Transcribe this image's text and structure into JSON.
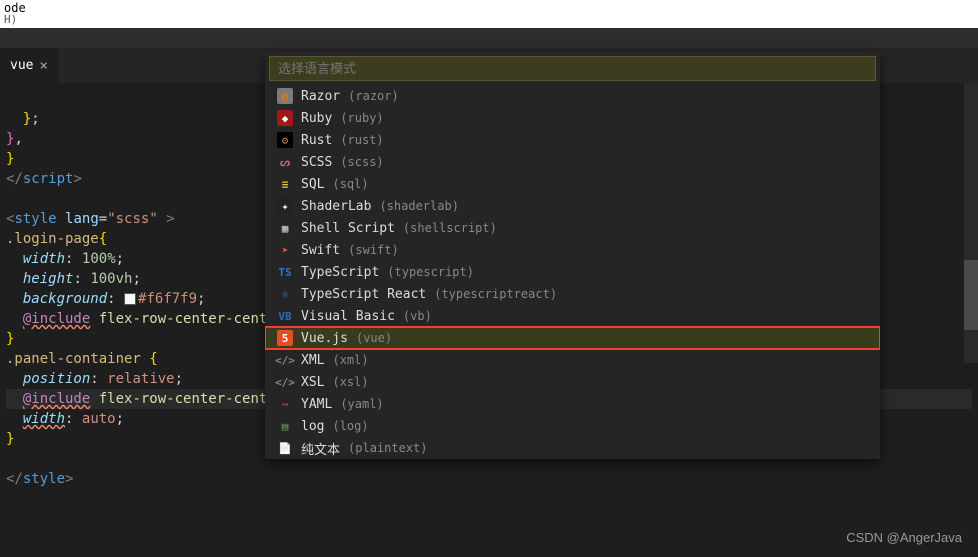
{
  "window": {
    "title_line1": "ode",
    "title_line2": "H)"
  },
  "tab": {
    "filename": "vue",
    "close_glyph": "×"
  },
  "code_lines": {
    "style_open_pre": "<",
    "style_tag": "style",
    "lang_attr": "lang",
    "lang_val": "\"scss\"",
    "style_open_post": " >",
    "sel_login": ".login-page",
    "prop_width": "width",
    "val_100pct": "100",
    "unit_pct": "%",
    "prop_height": "height",
    "val_100": "100",
    "unit_vh": "vh",
    "prop_bg": "background",
    "val_bg": "#f6f7f9",
    "include": "@include",
    "mixin1": "flex-row-center-center",
    "sel_panel": ".panel-container",
    "prop_pos": "position",
    "val_relative": "relative",
    "mixin2": "flex-row-center-cente",
    "val_auto": "auto",
    "script_close": "script",
    "style_close": "style"
  },
  "quickpick": {
    "placeholder": "选择语言模式",
    "items": [
      {
        "icon": "@",
        "iconBg": "#7a7a7a",
        "iconColor": "#d67a3a",
        "label": "Razor",
        "hint": "(razor)"
      },
      {
        "icon": "◆",
        "iconBg": "#a01818",
        "iconColor": "#fff",
        "label": "Ruby",
        "hint": "(ruby)"
      },
      {
        "icon": "⚙",
        "iconBg": "#000",
        "iconColor": "#c77b3a",
        "label": "Rust",
        "hint": "(rust)"
      },
      {
        "icon": "ᔕ",
        "iconBg": "transparent",
        "iconColor": "#cc6699",
        "label": "SCSS",
        "hint": "(scss)"
      },
      {
        "icon": "≡",
        "iconBg": "transparent",
        "iconColor": "#e8c83a",
        "label": "SQL",
        "hint": "(sql)"
      },
      {
        "icon": "✦",
        "iconBg": "#222",
        "iconColor": "#fff",
        "label": "ShaderLab",
        "hint": "(shaderlab)"
      },
      {
        "icon": "▦",
        "iconBg": "transparent",
        "iconColor": "#ccc",
        "label": "Shell Script",
        "hint": "(shellscript)"
      },
      {
        "icon": "➤",
        "iconBg": "transparent",
        "iconColor": "#f05138",
        "label": "Swift",
        "hint": "(swift)"
      },
      {
        "icon": "TS",
        "iconBg": "transparent",
        "iconColor": "#3178c6",
        "label": "TypeScript",
        "hint": "(typescript)"
      },
      {
        "icon": "⚛",
        "iconBg": "transparent",
        "iconColor": "#3178c6",
        "label": "TypeScript React",
        "hint": "(typescriptreact)"
      },
      {
        "icon": "VB",
        "iconBg": "transparent",
        "iconColor": "#2c6bb0",
        "label": "Visual Basic",
        "hint": "(vb)"
      },
      {
        "icon": "5",
        "iconBg": "#e44d26",
        "iconColor": "#fff",
        "label": "Vue.js",
        "hint": "(vue)",
        "selected": true,
        "highlighted": true
      },
      {
        "icon": "</>",
        "iconBg": "transparent",
        "iconColor": "#888",
        "label": "XML",
        "hint": "(xml)"
      },
      {
        "icon": "</>",
        "iconBg": "transparent",
        "iconColor": "#888",
        "label": "XSL",
        "hint": "(xsl)"
      },
      {
        "icon": "⋯",
        "iconBg": "transparent",
        "iconColor": "#c1305d",
        "label": "YAML",
        "hint": "(yaml)"
      },
      {
        "icon": "▤",
        "iconBg": "transparent",
        "iconColor": "#6a9955",
        "label": "log",
        "hint": "(log)"
      },
      {
        "icon": "📄",
        "iconBg": "transparent",
        "iconColor": "#ccc",
        "label": "纯文本",
        "hint": "(plaintext)"
      }
    ]
  },
  "watermark": "CSDN @AngerJava"
}
